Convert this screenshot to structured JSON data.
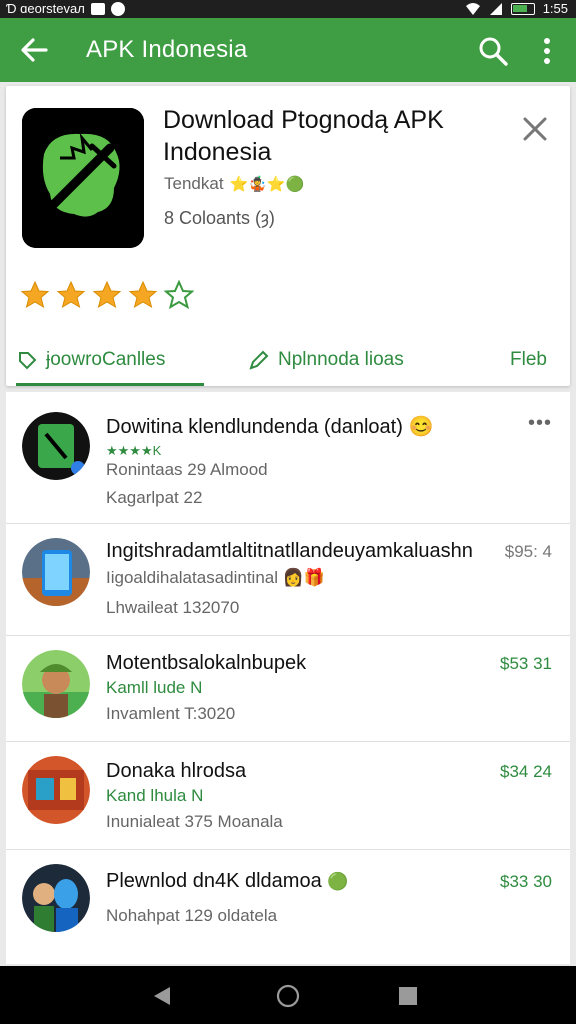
{
  "status_bar": {
    "left_text": "Ɗ ɑeorstevaл",
    "time": "1:55"
  },
  "app_bar": {
    "title": "APK Indonesia",
    "back_icon": "arrow-left-icon",
    "search_icon": "search-icon",
    "more_icon": "more-vert-icon"
  },
  "card": {
    "title": "Download Ptognodą APK Indonesia",
    "developer": "Tendkat",
    "developer_badges": "⭐🤹⭐🟢",
    "count": "8  Coloants (ȝ)",
    "rating_stars": 4,
    "close_icon": "close-icon",
    "tabs": [
      {
        "label": "ɉoowroCanlles",
        "icon": "tag-icon",
        "active": true
      },
      {
        "label": "Nplnnoda lioas",
        "icon": "pencil-icon",
        "active": false
      },
      {
        "label": "Fleb",
        "icon": "",
        "active": false
      }
    ]
  },
  "list": [
    {
      "title": "Dowitina klendlundenda (danloat)",
      "title_emoji": "😊",
      "sub1": "Ronintaas  29 Almood",
      "sub1_prefix": "★★★★K",
      "sub2": "Kagarlpat  22",
      "price": "",
      "menu": "•••"
    },
    {
      "title": "Ingitshradamtlaltitnatllandeuyamkaluashn",
      "title_emoji": "",
      "sub1": "Iigoaldihalatasadintinal",
      "sub1_prefix": "",
      "sub2": "Lhwaileat  132070",
      "price": "$95: 4",
      "menu": ""
    },
    {
      "title": "Motentbsalokalnbupek",
      "title_emoji": "",
      "sub1": "Kamll lude N",
      "sub1_prefix": "",
      "sub2": "Invamlent  T:3020",
      "price": "$53 31",
      "menu": ""
    },
    {
      "title": "Donaka hlrodsa",
      "title_emoji": "",
      "sub1": "Kand lhula N",
      "sub1_prefix": "",
      "sub2": "Inunialeat  375 Moanala",
      "price": "$34 24",
      "menu": ""
    },
    {
      "title": "Plewnlod dn4K dldamoa",
      "title_emoji": "🟢",
      "sub1": "",
      "sub1_prefix": "",
      "sub2": "Nohahpat  129 oldatela",
      "price": "$33 30",
      "menu": ""
    }
  ],
  "nav": {
    "back_icon": "nav-back-icon",
    "home_icon": "nav-home-icon",
    "recent_icon": "nav-recents-icon"
  }
}
